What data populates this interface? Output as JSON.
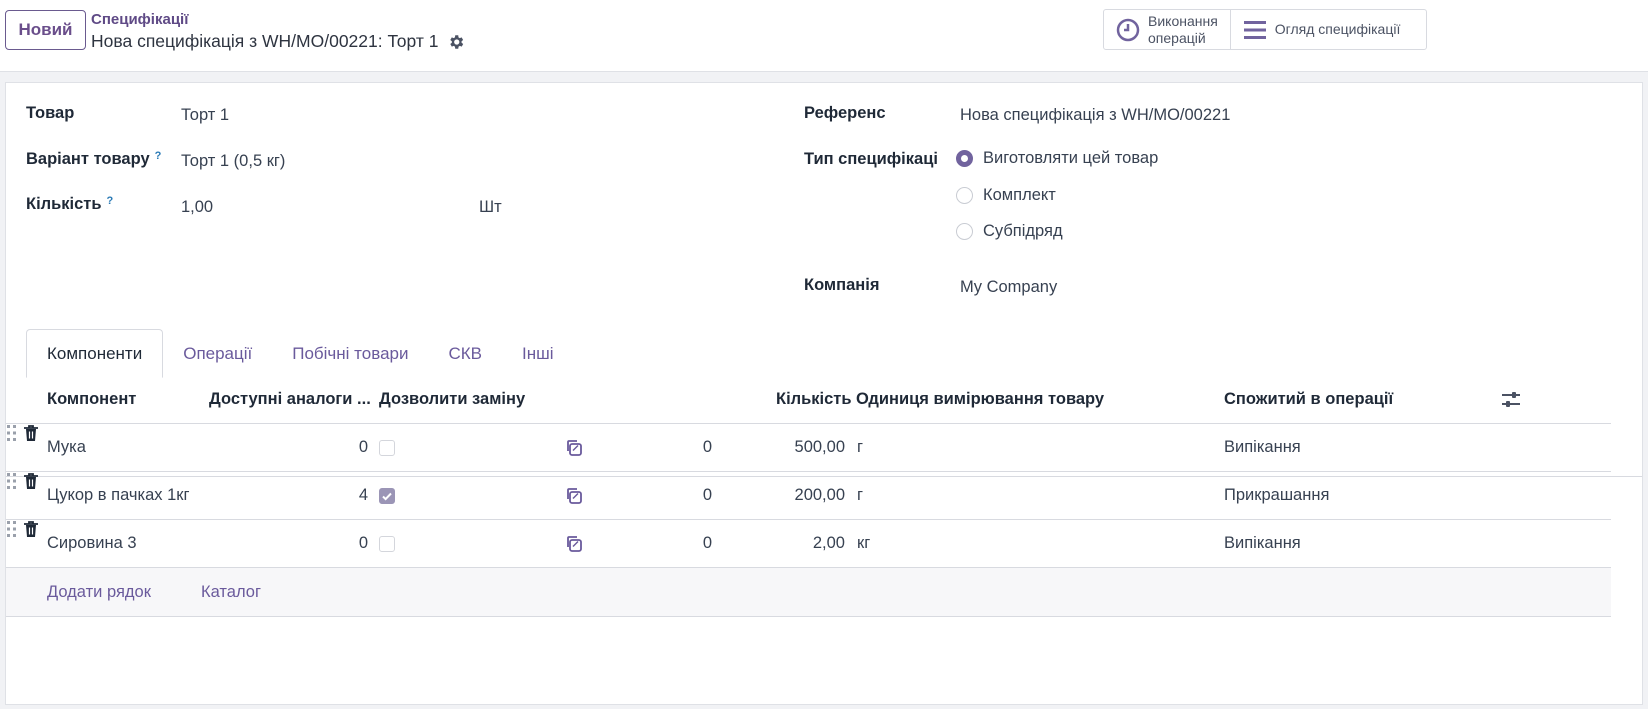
{
  "toolbar": {
    "new_label": "Новий"
  },
  "breadcrumb": {
    "parent": "Специфікації",
    "current": "Нова специфікація з WH/MO/00221: Торт 1"
  },
  "smart_buttons": [
    {
      "label_line1": "Виконання",
      "label_line2": "операцій",
      "icon": "clock-icon"
    },
    {
      "label": "Огляд специфікації",
      "icon": "bars-icon"
    }
  ],
  "form": {
    "product_label": "Товар",
    "product_value": "Торт 1",
    "variant_label": "Варіант товару",
    "variant_value": "Торт 1 (0,5 кг)",
    "qty_label": "Кількість",
    "qty_value": "1,00",
    "uom_value": "Шт",
    "help_mark": "?",
    "reference_label": "Референс",
    "reference_value": "Нова специфікація з WH/MO/00221",
    "type_label": "Тип специфікаці",
    "type_options": [
      "Виготовляти цей товар",
      "Комплект",
      "Субпідряд"
    ],
    "type_selected": 0,
    "company_label": "Компанія",
    "company_value": "My Company"
  },
  "tabs": [
    "Компоненти",
    "Операції",
    "Побічні товари",
    "СКВ",
    "Інші"
  ],
  "active_tab": 0,
  "table": {
    "headers": [
      "Компонент",
      "Доступні аналоги ...",
      "Дозволити заміну",
      "Кількість",
      "Одиниця вимірювання товару",
      "Спожитий в операції"
    ],
    "rows": [
      {
        "component": "Мука",
        "alternatives": "0",
        "allow_sub": false,
        "extra": "0",
        "qty": "500,00",
        "uom": "г",
        "operation": "Випікання"
      },
      {
        "component": "Цукор в пачках 1кг",
        "alternatives": "4",
        "allow_sub": true,
        "extra": "0",
        "qty": "200,00",
        "uom": "г",
        "operation": "Прикрашання"
      },
      {
        "component": "Сировина 3",
        "alternatives": "0",
        "allow_sub": false,
        "extra": "0",
        "qty": "2,00",
        "uom": "кг",
        "operation": "Випікання"
      }
    ],
    "add_line": "Додати рядок",
    "catalog": "Каталог"
  }
}
